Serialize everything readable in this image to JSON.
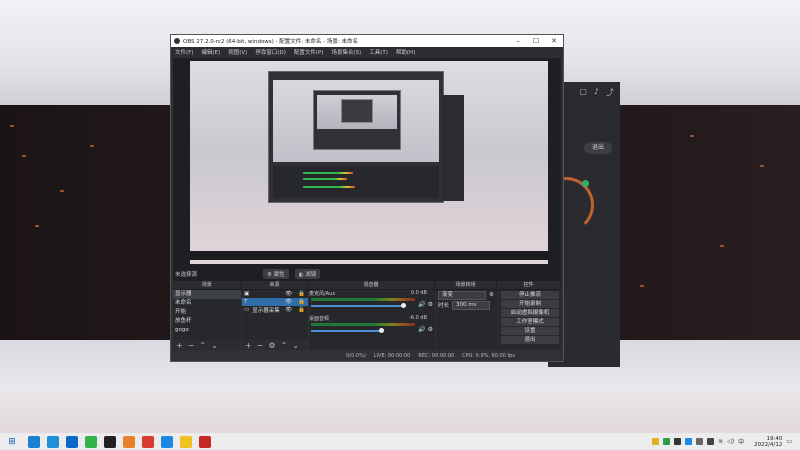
{
  "obs": {
    "title": "OBS 27.2.0-rc2 (64-bit, windows) - 配置文件: 未命名 - 场景: 未命名",
    "menu": [
      "文件(F)",
      "编辑(E)",
      "视图(V)",
      "停靠窗口(D)",
      "配置文件(P)",
      "场景集合(S)",
      "工具(T)",
      "帮助(H)"
    ],
    "no_source": "未选择源",
    "properties_btn": "属性",
    "filters_btn": "滤镜",
    "docks": {
      "scenes": "场景",
      "sources": "来源",
      "mixer": "混音器",
      "transitions": "场景转场",
      "controls": "控件"
    },
    "scenes": [
      "显示器",
      "未命名",
      "开始",
      "放鱼杆",
      "gogo"
    ],
    "sources": [
      "显示器采集"
    ],
    "mixer": [
      {
        "name": "麦克风/Aux",
        "db": "0.0 dB"
      },
      {
        "name": "桌面音频",
        "db": "-6.0 dB"
      }
    ],
    "transition": {
      "type": "渐变",
      "duration_label": "时长",
      "duration": "300 ms"
    },
    "controls": [
      "停止推流",
      "开始录制",
      "启动虚拟摄像机",
      "工作室模式",
      "设置",
      "退出"
    ],
    "status": {
      "drop": "0(0.0%)",
      "live": "LIVE: 00:00:00",
      "rec": "REC: 00:00:00",
      "cpu": "CPU: 0.9%, 60.00 fps"
    }
  },
  "bg_app": {
    "logout": "退出"
  },
  "taskbar": {
    "time": "19:40",
    "date": "2022/4/12"
  },
  "colors": {
    "obs_bg": "#2f3136",
    "selected_source": "#2f6ea8",
    "meter_green": "#2db84e"
  }
}
